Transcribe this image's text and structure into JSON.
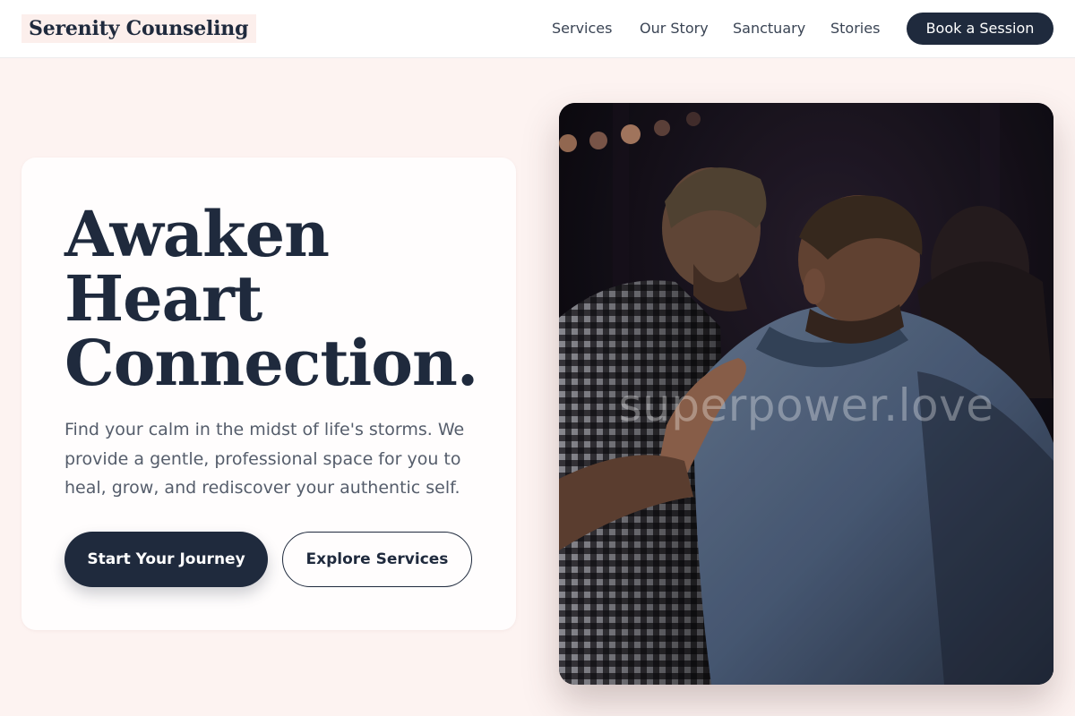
{
  "brand": {
    "name": "Serenity Counseling"
  },
  "nav": {
    "items": [
      {
        "label": "Services"
      },
      {
        "label": "Our Story"
      },
      {
        "label": "Sanctuary"
      },
      {
        "label": "Stories"
      }
    ],
    "cta_label": "Book a Session"
  },
  "hero": {
    "headline_lines": [
      "Awaken",
      "Heart",
      "Connection."
    ],
    "subtext": "Find your calm in the midst of life's storms. We provide a gentle, professional space for you to heal, grow, and rediscover your authentic self.",
    "primary_button": "Start Your Journey",
    "secondary_button": "Explore Services",
    "image": {
      "alt": "Two people with heads bowed, one resting a hand on the other's shoulder",
      "watermark": "superpower.love"
    }
  },
  "colors": {
    "page_background": "#fdf3f1",
    "navy": "#1f2a3d",
    "text_muted": "#555d6b",
    "card_background": "#fffdfd"
  }
}
